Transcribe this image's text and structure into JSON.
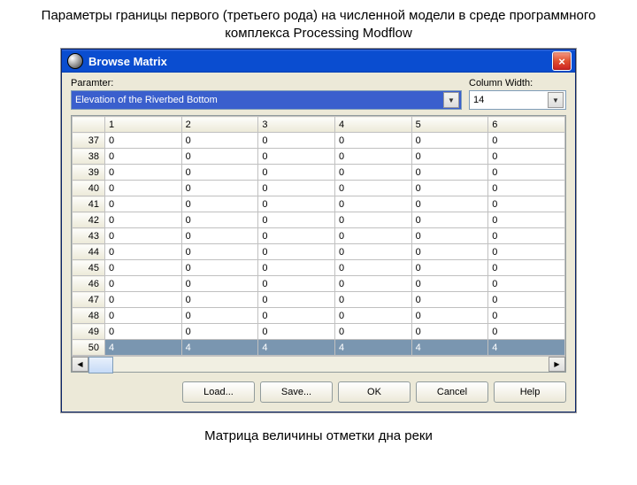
{
  "page_heading": "Параметры границы первого (третьего рода) на численной модели в среде программного комплекса Processing Modflow",
  "caption": "Матрица величины отметки дна реки",
  "window": {
    "title": "Browse Matrix",
    "close_label": "×",
    "param_label": "Paramter:",
    "param_value": "Elevation of the Riverbed Bottom",
    "colwidth_label": "Column Width:",
    "colwidth_value": "14",
    "columns": [
      "1",
      "2",
      "3",
      "4",
      "5",
      "6"
    ],
    "rows": [
      {
        "n": "37",
        "v": [
          "0",
          "0",
          "0",
          "0",
          "0",
          "0"
        ]
      },
      {
        "n": "38",
        "v": [
          "0",
          "0",
          "0",
          "0",
          "0",
          "0"
        ]
      },
      {
        "n": "39",
        "v": [
          "0",
          "0",
          "0",
          "0",
          "0",
          "0"
        ]
      },
      {
        "n": "40",
        "v": [
          "0",
          "0",
          "0",
          "0",
          "0",
          "0"
        ]
      },
      {
        "n": "41",
        "v": [
          "0",
          "0",
          "0",
          "0",
          "0",
          "0"
        ]
      },
      {
        "n": "42",
        "v": [
          "0",
          "0",
          "0",
          "0",
          "0",
          "0"
        ]
      },
      {
        "n": "43",
        "v": [
          "0",
          "0",
          "0",
          "0",
          "0",
          "0"
        ]
      },
      {
        "n": "44",
        "v": [
          "0",
          "0",
          "0",
          "0",
          "0",
          "0"
        ]
      },
      {
        "n": "45",
        "v": [
          "0",
          "0",
          "0",
          "0",
          "0",
          "0"
        ]
      },
      {
        "n": "46",
        "v": [
          "0",
          "0",
          "0",
          "0",
          "0",
          "0"
        ]
      },
      {
        "n": "47",
        "v": [
          "0",
          "0",
          "0",
          "0",
          "0",
          "0"
        ]
      },
      {
        "n": "48",
        "v": [
          "0",
          "0",
          "0",
          "0",
          "0",
          "0"
        ]
      },
      {
        "n": "49",
        "v": [
          "0",
          "0",
          "0",
          "0",
          "0",
          "0"
        ]
      },
      {
        "n": "50",
        "v": [
          "4",
          "4",
          "4",
          "4",
          "4",
          "4"
        ],
        "selected": true
      }
    ],
    "buttons": {
      "load": "Load...",
      "save": "Save...",
      "ok": "OK",
      "cancel": "Cancel",
      "help": "Help"
    }
  }
}
